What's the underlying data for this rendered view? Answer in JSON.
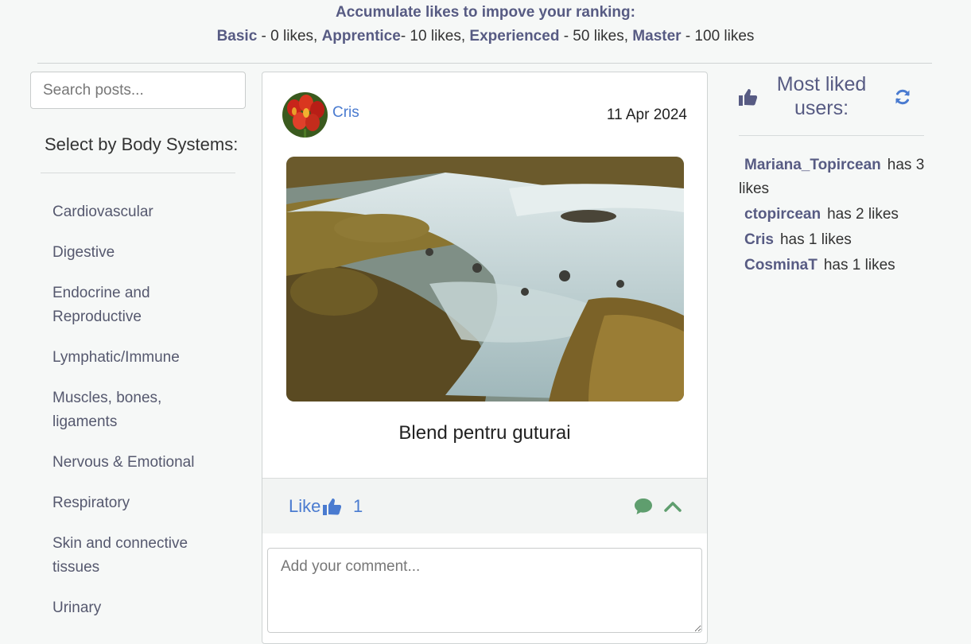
{
  "ranking": {
    "heading": "Accumulate likes to impove your ranking:",
    "levels": [
      {
        "name": "Basic",
        "rest": " - 0 likes, "
      },
      {
        "name": "Apprentice",
        "rest": "- 10 likes, "
      },
      {
        "name": "Experienced",
        "rest": " - 50 likes, "
      },
      {
        "name": "Master",
        "rest": " - 100 likes"
      }
    ]
  },
  "sidebar": {
    "search_placeholder": "Search posts...",
    "select_title": "Select by Body Systems:",
    "systems": [
      "Cardiovascular",
      "Digestive",
      "Endocrine and Reproductive",
      "Lymphatic/Immune",
      "Muscles, bones, ligaments",
      "Nervous & Emotional",
      "Respiratory",
      "Skin and connective tissues",
      "Urinary"
    ]
  },
  "post": {
    "author": "Cris",
    "date": "11 Apr 2024",
    "title": "Blend pentru guturai",
    "like_label": "Like",
    "like_count": "1",
    "comment_placeholder": "Add your comment..."
  },
  "most_liked": {
    "title": "Most liked users:",
    "suffix": "has",
    "unit": "likes",
    "users": [
      {
        "name": "Mariana_Topircean",
        "likes": "3"
      },
      {
        "name": "ctopircean",
        "likes": "2"
      },
      {
        "name": "Cris",
        "likes": "1"
      },
      {
        "name": "CosminaT",
        "likes": "1"
      }
    ]
  },
  "colors": {
    "accent_blue": "#4a7bd0",
    "heading_purple": "#575b83",
    "comment_green": "#5f9e6e"
  }
}
